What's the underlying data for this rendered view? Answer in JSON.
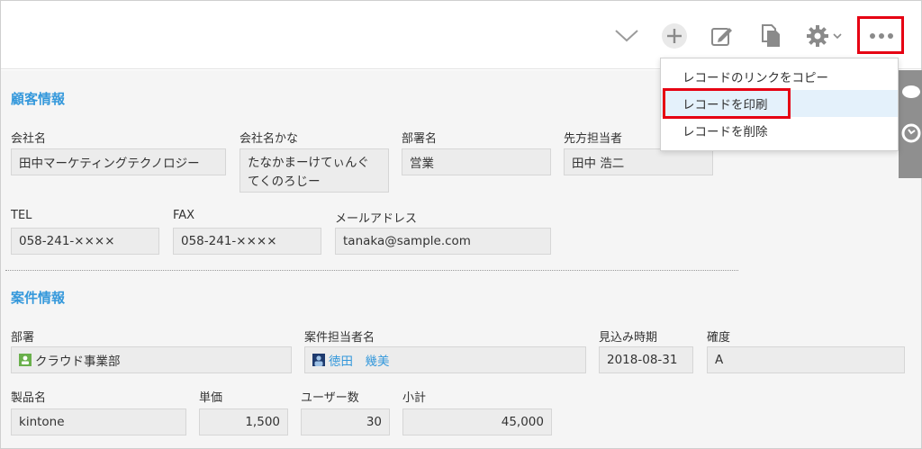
{
  "toolbar": {
    "icons": [
      "chevron-down-icon",
      "plus-icon",
      "edit-icon",
      "copy-icon",
      "gear-icon",
      "more-icon"
    ]
  },
  "menu": {
    "items": [
      {
        "label": "レコードのリンクをコピー"
      },
      {
        "label": "レコードを印刷"
      },
      {
        "label": "レコードを削除"
      }
    ]
  },
  "customer": {
    "title": "顧客情報",
    "company_label": "会社名",
    "company_value": "田中マーケティングテクノロジー",
    "kana_label": "会社名かな",
    "kana_value": "たなかまーけてぃんぐてくのろじー",
    "dept_label": "部署名",
    "dept_value": "営業",
    "contact_label": "先方担当者",
    "contact_value": "田中 浩二",
    "tel_label": "TEL",
    "tel_value": "058-241-××××",
    "fax_label": "FAX",
    "fax_value": "058-241-××××",
    "email_label": "メールアドレス",
    "email_value": "tanaka@sample.com"
  },
  "project": {
    "title": "案件情報",
    "busho_label": "部署",
    "busho_value": "クラウド事業部",
    "owner_label": "案件担当者名",
    "owner_value": "徳田　幾美",
    "date_label": "見込み時期",
    "date_value": "2018-08-31",
    "certainty_label": "確度",
    "certainty_value": "A",
    "product_label": "製品名",
    "product_value": "kintone",
    "price_label": "単価",
    "price_value": "1,500",
    "users_label": "ユーザー数",
    "users_value": "30",
    "subtotal_label": "小計",
    "subtotal_value": "45,000"
  },
  "colors": {
    "accent": "#3498db",
    "highlight": "#e60012"
  }
}
